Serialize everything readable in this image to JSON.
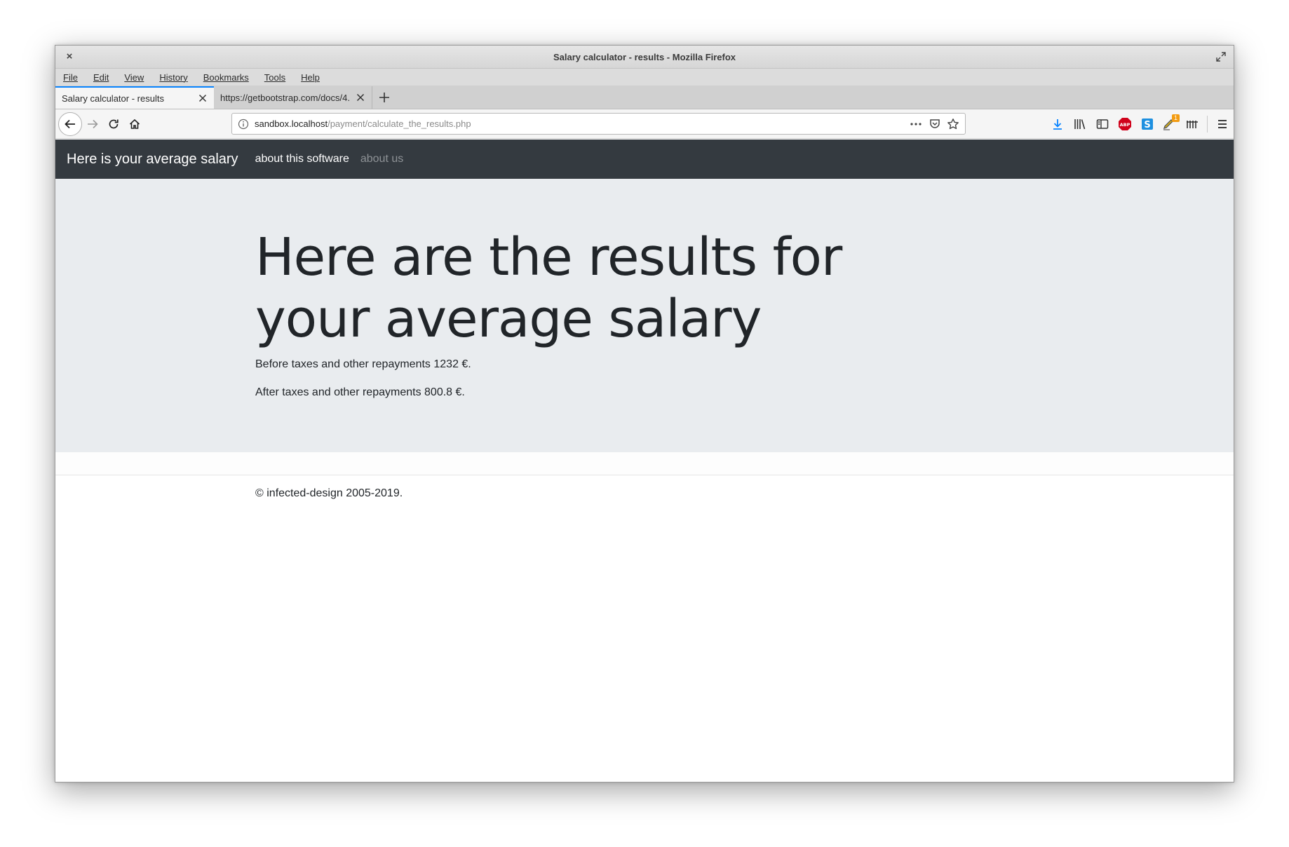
{
  "window": {
    "title": "Salary calculator - results - Mozilla Firefox"
  },
  "menubar": {
    "items": [
      "File",
      "Edit",
      "View",
      "History",
      "Bookmarks",
      "Tools",
      "Help"
    ]
  },
  "tabs": [
    {
      "label": "Salary calculator - results",
      "active": true
    },
    {
      "label": "https://getbootstrap.com/docs/4.",
      "active": false
    }
  ],
  "urlbar": {
    "host": "sandbox.localhost",
    "path": "/payment/calculate_the_results.php"
  },
  "toolbar": {
    "notification_count": "1"
  },
  "site": {
    "brand": "Here is your average salary",
    "nav": {
      "about_software": "about this software",
      "about_us": "about us"
    },
    "heading": "Here are the results for your average salary",
    "before_taxes": "Before taxes and other repayments 1232 €.",
    "after_taxes": "After taxes and other repayments 800.8 €.",
    "footer": "© infected-design 2005-2019."
  },
  "colors": {
    "site_navbar_bg": "#343a40",
    "jumbotron_bg": "#e9ecef",
    "active_tab_accent": "#0a84ff"
  }
}
